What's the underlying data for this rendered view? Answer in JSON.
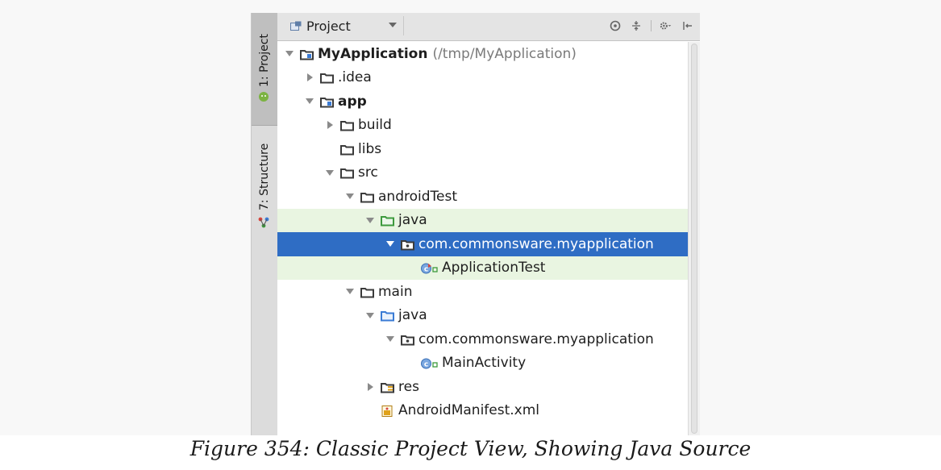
{
  "sidebar": {
    "tabs": [
      {
        "label": "1: Project",
        "icon": "android-icon"
      },
      {
        "label": "7: Structure",
        "icon": "structure-icon"
      }
    ]
  },
  "panel": {
    "view_selector": "Project",
    "toolbar_icons": [
      "target-icon",
      "collapse-icon",
      "gear-icon",
      "hide-icon"
    ]
  },
  "tree": [
    {
      "depth": 0,
      "expand": "down",
      "icon": "module-folder-icon",
      "label": "MyApplication",
      "bold": true,
      "path": "(/tmp/MyApplication)",
      "state": ""
    },
    {
      "depth": 1,
      "expand": "right",
      "icon": "folder-icon",
      "label": ".idea",
      "state": ""
    },
    {
      "depth": 1,
      "expand": "down",
      "icon": "module-folder-icon",
      "label": "app",
      "bold": true,
      "state": ""
    },
    {
      "depth": 2,
      "expand": "right",
      "icon": "folder-icon",
      "label": "build",
      "state": ""
    },
    {
      "depth": 2,
      "expand": "none",
      "icon": "folder-icon",
      "label": "libs",
      "state": ""
    },
    {
      "depth": 2,
      "expand": "down",
      "icon": "folder-icon",
      "label": "src",
      "state": ""
    },
    {
      "depth": 3,
      "expand": "down",
      "icon": "folder-icon",
      "label": "androidTest",
      "state": ""
    },
    {
      "depth": 4,
      "expand": "down",
      "icon": "test-folder-icon",
      "label": "java",
      "state": "test"
    },
    {
      "depth": 5,
      "expand": "down",
      "icon": "package-icon",
      "label": "com.commonsware.myapplication",
      "state": "selected"
    },
    {
      "depth": 6,
      "expand": "none",
      "icon": "test-class-icon",
      "label": "ApplicationTest",
      "state": "test"
    },
    {
      "depth": 3,
      "expand": "down",
      "icon": "folder-icon",
      "label": "main",
      "state": ""
    },
    {
      "depth": 4,
      "expand": "down",
      "icon": "source-folder-icon",
      "label": "java",
      "state": ""
    },
    {
      "depth": 5,
      "expand": "down",
      "icon": "package-icon",
      "label": "com.commonsware.myapplication",
      "state": ""
    },
    {
      "depth": 6,
      "expand": "none",
      "icon": "class-icon",
      "label": "MainActivity",
      "state": ""
    },
    {
      "depth": 4,
      "expand": "right",
      "icon": "resources-folder-icon",
      "label": "res",
      "state": ""
    },
    {
      "depth": 4,
      "expand": "none",
      "icon": "manifest-file-icon",
      "label": "AndroidManifest.xml",
      "state": ""
    }
  ],
  "caption": "Figure 354: Classic Project View, Showing Java Source",
  "colors": {
    "selection": "#2f6dc4",
    "test_highlight": "#e9f5e1",
    "folder": "#3b3b3b",
    "source_folder": "#3a7bd5",
    "test_folder": "#3d9a3d"
  }
}
